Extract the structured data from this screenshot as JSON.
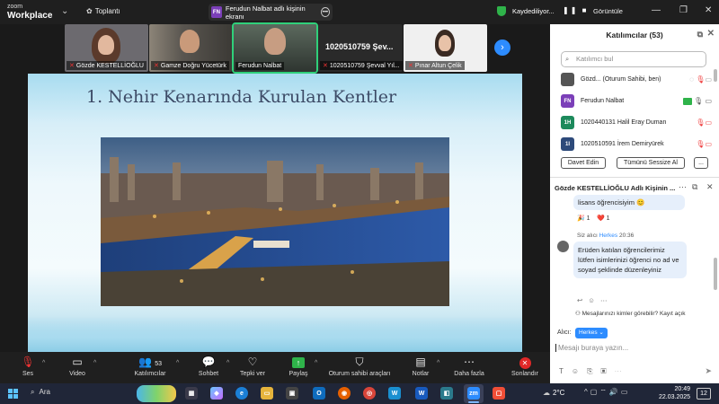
{
  "topbar": {
    "logo_top": "zoom",
    "logo_bottom": "Workplace",
    "meeting_label": "Toplantı",
    "share_badge": "FN",
    "share_label": "Ferudun Nalbat adlı kişinin ekranı",
    "recording_label": "Kaydediliyor...",
    "view_label": "Görüntüle"
  },
  "participants_strip": [
    {
      "name": "Gözde KESTELLİOĞLU"
    },
    {
      "name": "Gamze Doğru Yücetürk"
    },
    {
      "name": "Ferudun Nalbat"
    },
    {
      "name": "1020510759 Şevval Yıl..."
    },
    {
      "name": "Pınar Altun Çelik"
    }
  ],
  "strip_big_name": "1020510759 Şev...",
  "slide": {
    "title": "1. Nehir Kenarında Kurulan Kentler"
  },
  "toolbar": {
    "audio": "Ses",
    "video": "Video",
    "participants": "Katılımcılar",
    "participants_count": "53",
    "chat": "Sohbet",
    "react": "Tepki ver",
    "share": "Paylaş",
    "host_tools": "Oturum sahibi araçları",
    "notes": "Notlar",
    "more": "Daha fazla",
    "end": "Sonlandır"
  },
  "panel": {
    "title": "Katılımcılar (53)",
    "search_placeholder": "Katılımcı bul",
    "participants": [
      {
        "initials": "",
        "name": "Gözd... (Oturum Sahibi, ben)",
        "color": "#555555"
      },
      {
        "initials": "FN",
        "name": "Ferudun Nalbat",
        "color": "#7b3fb8"
      },
      {
        "initials": "1H",
        "name": "1020440131 Halil Eray Duman",
        "color": "#1d8a5c"
      },
      {
        "initials": "1I",
        "name": "1020510591 İrem Demiryürek",
        "color": "#2d4a7a"
      }
    ],
    "invite_button": "Davet Edin",
    "mute_all_button": "Tümünü Sessize Al",
    "more_button": "...",
    "chat_title": "Gözde KESTELLİOĞLU Adlı Kişinin ...",
    "prev_message_tail": "lisans öğrencisiyim 😊",
    "reaction_1": "🎉 1",
    "reaction_2": "❤️ 1",
    "sender_prefix": "Siz alıcı",
    "sender_to": "Herkes",
    "sender_time": "20:36",
    "message": "Erüden katılan öğrencilerimiz lütfen isimlerinizi öğrenci no ad ve soyad şeklinde düzenleyiniz",
    "visibility_note": "Mesajlarınızı kimler görebilir? Kayıt açık",
    "to_label": "Alıcı:",
    "to_value": "Herkes",
    "input_placeholder": "Mesajı buraya yazın..."
  },
  "taskbar": {
    "search_label": "Ara",
    "temperature": "2°C",
    "time": "20:49",
    "date": "22.03.2025",
    "notifications": "12"
  }
}
